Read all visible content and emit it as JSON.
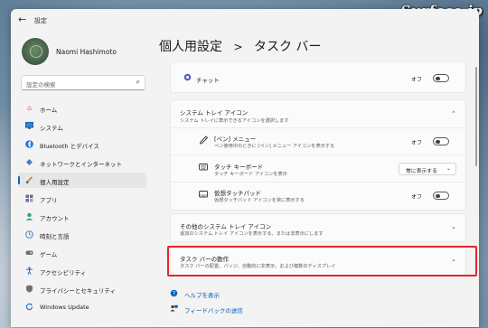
{
  "watermark": "Surface.jp",
  "app": {
    "title": "設定",
    "back_icon": "back-arrow-icon"
  },
  "user": {
    "name": "Naomi Hashimoto"
  },
  "search": {
    "placeholder": "設定の検索"
  },
  "sidebar": {
    "items": [
      {
        "label": "ホーム",
        "icon": "home-icon",
        "color": "#e2693a"
      },
      {
        "label": "システム",
        "icon": "monitor-icon",
        "color": "#2b88d8"
      },
      {
        "label": "Bluetooth とデバイス",
        "icon": "bluetooth-icon",
        "color": "#1f74d4"
      },
      {
        "label": "ネットワークとインターネット",
        "icon": "wifi-icon",
        "color": "#4a7fb8"
      },
      {
        "label": "個人用設定",
        "icon": "paintbrush-icon",
        "color": "#d48433",
        "selected": true
      },
      {
        "label": "アプリ",
        "icon": "apps-icon",
        "color": "#6b6b9b"
      },
      {
        "label": "アカウント",
        "icon": "account-icon",
        "color": "#2ea37a"
      },
      {
        "label": "時刻と言語",
        "icon": "globe-clock-icon",
        "color": "#3c7dc4"
      },
      {
        "label": "ゲーム",
        "icon": "gamepad-icon",
        "color": "#6e6e6e"
      },
      {
        "label": "アクセシビリティ",
        "icon": "accessibility-icon",
        "color": "#2a6fb3"
      },
      {
        "label": "プライバシーとセキュリティ",
        "icon": "shield-icon",
        "color": "#707070"
      },
      {
        "label": "Windows Update",
        "icon": "update-icon",
        "color": "#1f74d4"
      }
    ]
  },
  "breadcrumb": {
    "parent": "個人用設定",
    "separator": ">",
    "current": "タスク バー"
  },
  "content": {
    "chat": {
      "label": "チャット",
      "state": "オフ"
    },
    "tray": {
      "title": "システム トレイ アイコン",
      "subtitle": "システム トレイに表示できるアイコンを選択します",
      "items": [
        {
          "title": "[ペン] メニュー",
          "subtitle": "ペン使用中のときに [ペン] メニュー アイコンを表示する",
          "control": "toggle",
          "state": "オフ"
        },
        {
          "title": "タッチ キーボード",
          "subtitle": "タッチ キーボード アイコンを表示",
          "control": "dropdown",
          "value": "常に表示する"
        },
        {
          "title": "仮想タッチパッド",
          "subtitle": "仮想タッチパッド アイコンを常に表示する",
          "control": "toggle",
          "state": "オフ"
        }
      ]
    },
    "other_tray": {
      "title": "その他のシステム トレイ アイコン",
      "subtitle": "追加のシステム トレイ アイコンを表示する、または非表示にします"
    },
    "behavior": {
      "title": "タスク バーの動作",
      "subtitle": "タスク バーの配置、バッジ、自動的に非表示、および複数のディスプレイ"
    }
  },
  "links": {
    "help": "ヘルプを表示",
    "feedback": "フィードバックの送信"
  },
  "colors": {
    "accent": "#0067c0",
    "highlight": "#e4262b"
  }
}
